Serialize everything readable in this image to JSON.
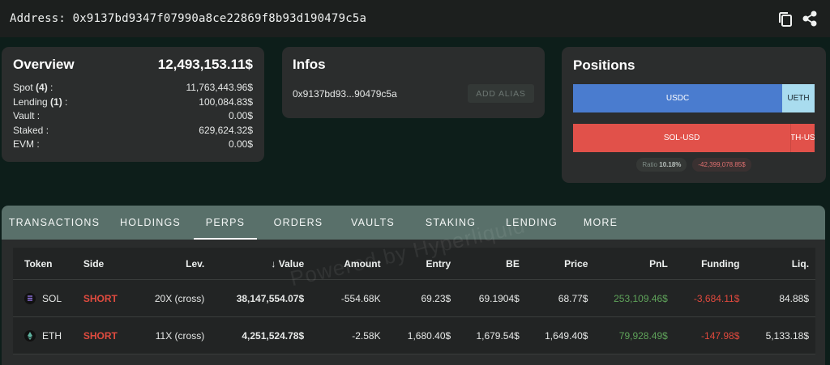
{
  "address_bar": {
    "label": "Address:",
    "address": "0x9137bd9347f07990a8ce22869f8b93d190479c5a",
    "icons": [
      "copy-icon",
      "share-icon"
    ]
  },
  "overview": {
    "title": "Overview",
    "total": "12,493,153.11$",
    "rows": [
      {
        "label": "Spot ",
        "count": "(4)",
        "suffix": " :",
        "value": "11,763,443.96$"
      },
      {
        "label": "Lending ",
        "count": "(1)",
        "suffix": " :",
        "value": "100,084.83$"
      },
      {
        "label": "Vault :",
        "count": "",
        "suffix": "",
        "value": "0.00$"
      },
      {
        "label": "Staked :",
        "count": "",
        "suffix": "",
        "value": "629,624.32$"
      },
      {
        "label": "EVM :",
        "count": "",
        "suffix": "",
        "value": "0.00$"
      }
    ]
  },
  "infos": {
    "title": "Infos",
    "short_address": "0x9137bd93...90479c5a",
    "add_alias_label": "ADD ALIAS"
  },
  "positions": {
    "title": "Positions",
    "bar1": [
      {
        "label": "USDC",
        "share": 0.866,
        "color": "#4a7ccf"
      },
      {
        "label": "UETH",
        "share": 0.134,
        "color": "#a9dcef"
      }
    ],
    "bar2": [
      {
        "label": "SOL-USD",
        "share": 0.9,
        "color": "#e1514a"
      },
      {
        "label": "ETH-USD",
        "share": 0.1,
        "color": "#e1514a"
      }
    ],
    "ratio_label": "Ratio",
    "ratio_value": "10.18%",
    "pnl": "-42,399,078.85$"
  },
  "tabs": [
    {
      "label": "TRANSACTIONS",
      "active": false
    },
    {
      "label": "HOLDINGS",
      "active": false
    },
    {
      "label": "PERPS",
      "active": true
    },
    {
      "label": "ORDERS",
      "active": false
    },
    {
      "label": "VAULTS",
      "active": false
    },
    {
      "label": "STAKING",
      "active": false
    },
    {
      "label": "LENDING",
      "active": false
    },
    {
      "label": "MORE",
      "active": false
    }
  ],
  "table": {
    "headers": {
      "token": "Token",
      "side": "Side",
      "lev": "Lev.",
      "value": "Value",
      "value_sort": "↓",
      "amount": "Amount",
      "entry": "Entry",
      "be": "BE",
      "price": "Price",
      "pnl": "PnL",
      "funding": "Funding",
      "liq": "Liq."
    },
    "rows": [
      {
        "token": "SOL",
        "icon": "solana-icon",
        "side": "SHORT",
        "lev": "20X (cross)",
        "value": "38,147,554.07$",
        "amount": "-554.68K",
        "entry": "69.23$",
        "be": "69.1904$",
        "price": "68.77$",
        "pnl": "253,109.46$",
        "funding": "-3,684.11$",
        "liq": "84.88$"
      },
      {
        "token": "ETH",
        "icon": "ethereum-icon",
        "side": "SHORT",
        "lev": "11X (cross)",
        "value": "4,251,524.78$",
        "amount": "-2.58K",
        "entry": "1,680.40$",
        "be": "1,679.54$",
        "price": "1,649.40$",
        "pnl": "79,928.49$",
        "funding": "-147.98$",
        "liq": "5,133.18$"
      }
    ]
  },
  "watermark": "Powered by Hyperliquid"
}
